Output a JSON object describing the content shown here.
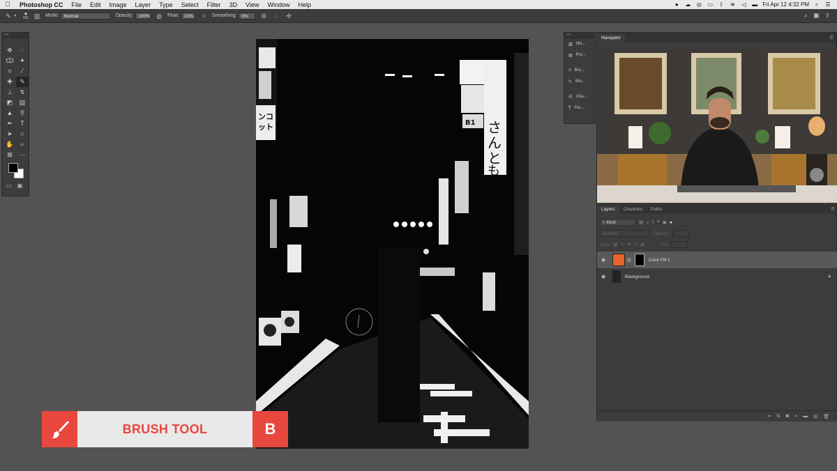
{
  "menubar": {
    "apple": "",
    "app_name": "Photoshop CC",
    "menus": [
      "File",
      "Edit",
      "Image",
      "Layer",
      "Type",
      "Select",
      "Filter",
      "3D",
      "View",
      "Window",
      "Help"
    ],
    "clock": "Fri Apr 12  4:32 PM"
  },
  "options": {
    "brush_size": "411",
    "mode_label": "Mode:",
    "mode_value": "Normal",
    "opacity_label": "Opacity:",
    "opacity_value": "100%",
    "flow_label": "Flow:",
    "flow_value": "10%",
    "smoothing_label": "Smoothing:",
    "smoothing_value": "0%"
  },
  "side_panels": {
    "items": [
      "His...",
      "Pro...",
      "Bru...",
      "Bru...",
      "Cha...",
      "Par..."
    ]
  },
  "navigator": {
    "tab": "Navigator"
  },
  "layers_panel": {
    "tabs": [
      "Layers",
      "Channels",
      "Paths"
    ],
    "filter_label": "Kind",
    "blend_mode": "Normal",
    "opacity_label": "Opacity:",
    "lock_label": "Lock:",
    "fill_label": "Fill:",
    "layers": [
      {
        "name": "Color Fill 1",
        "selected": true,
        "color": "#e8642a"
      },
      {
        "name": "Background",
        "selected": false
      }
    ]
  },
  "tooltip": {
    "label": "BRUSH TOOL",
    "shortcut": "B",
    "accent": "#e8473e"
  },
  "canvas_text": {
    "sign_vertical": "さんとも",
    "sign_left": "ンコ\nット",
    "sign_b1": "B1"
  },
  "colors": {
    "panel": "#3c3c3c",
    "workspace": "#535353",
    "foreground_swatch": "#000000",
    "background_swatch": "#ffffff"
  }
}
